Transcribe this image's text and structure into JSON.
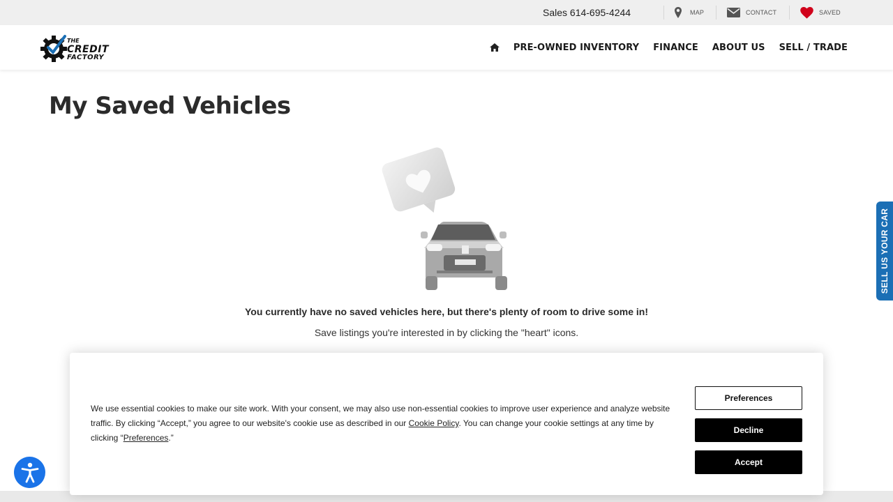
{
  "topbar": {
    "phone": "Sales 614-695-4244",
    "map_label": "MAP",
    "contact_label": "CONTACT",
    "saved_label": "SAVED",
    "icons": [
      "map-pin-icon",
      "envelope-icon",
      "heart-icon"
    ]
  },
  "logo": {
    "line1": "THE",
    "line2": "CREDIT",
    "line3": "FACTORY"
  },
  "nav": {
    "items": [
      {
        "label": "PRE-OWNED INVENTORY"
      },
      {
        "label": "FINANCE"
      },
      {
        "label": "ABOUT US"
      },
      {
        "label": "SELL / TRADE"
      }
    ]
  },
  "page": {
    "title": "My Saved Vehicles",
    "empty_main": "You currently have no saved vehicles here, but there's plenty of room to drive some in!",
    "empty_sub": "Save listings you're interested in by clicking the \"heart\" icons."
  },
  "side_tab": {
    "label": "SELL US YOUR CAR"
  },
  "cookie": {
    "text_part1": "We use essential cookies to make our site work. With your consent, we may also use non-essential cookies to improve user experience and analyze website traffic. By clicking “Accept,” you agree to our website's cookie use as described in our ",
    "policy_link": "Cookie Policy",
    "text_part2": ". You can change your cookie settings at any time by clicking “",
    "preferences_link": "Preferences",
    "text_part3": ".”",
    "preferences_button": "Preferences",
    "decline_button": "Decline",
    "accept_button": "Accept"
  },
  "colors": {
    "accent_blue": "#1b6fb5",
    "heart_red": "#d0021b",
    "a11y_blue": "#1a73e8"
  }
}
